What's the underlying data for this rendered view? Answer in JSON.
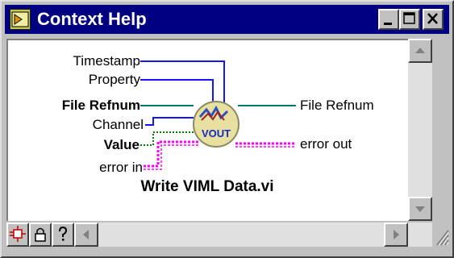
{
  "window": {
    "title": "Context Help",
    "app_icon": "labview-help-icon",
    "controls": [
      "minimize-icon",
      "maximize-icon",
      "close-icon"
    ]
  },
  "help": {
    "vi_name": "Write VIML Data.vi",
    "vi_icon_text": "VOUT",
    "inputs": [
      {
        "label": "Timestamp",
        "bold": false
      },
      {
        "label": "Property",
        "bold": false
      },
      {
        "label": "File Refnum",
        "bold": true
      },
      {
        "label": "Channel",
        "bold": false
      },
      {
        "label": "Value",
        "bold": true
      },
      {
        "label": "error in",
        "bold": false
      }
    ],
    "outputs": [
      {
        "label": "File Refnum",
        "bold": false
      },
      {
        "label": "error out",
        "bold": false
      }
    ],
    "wire_colors": {
      "timestamp": "#1414ff",
      "property": "#1414ff",
      "refnum": "#007878",
      "channel": "#1414ff",
      "value": "#008000",
      "error": "#ff00ff"
    }
  },
  "toolbar": {
    "buttons": [
      "simple-diagram-icon",
      "lock-icon",
      "help-question-icon"
    ]
  }
}
